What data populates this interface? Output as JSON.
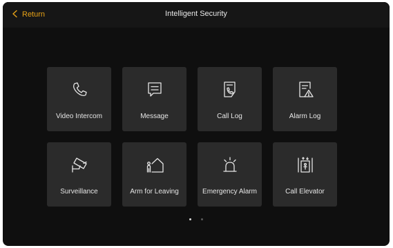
{
  "header": {
    "back_label": "Return",
    "title": "Intelligent Security"
  },
  "tiles": [
    {
      "label": "Video Intercom",
      "icon": "phone-icon"
    },
    {
      "label": "Message",
      "icon": "message-icon"
    },
    {
      "label": "Call Log",
      "icon": "call-log-icon"
    },
    {
      "label": "Alarm Log",
      "icon": "alarm-log-icon"
    },
    {
      "label": "Surveillance",
      "icon": "camera-icon"
    },
    {
      "label": "Arm for Leaving",
      "icon": "arm-leaving-icon"
    },
    {
      "label": "Emergency Alarm",
      "icon": "siren-icon"
    },
    {
      "label": "Call Elevator",
      "icon": "elevator-icon"
    }
  ],
  "pagination": {
    "pages": 2,
    "current": 1
  },
  "colors": {
    "accent": "#e8a317",
    "background": "#0f0f0f",
    "tile": "#2b2b2b",
    "text": "#e6e6e6",
    "dot_active": "#d9d9d9",
    "dot_inactive": "#5a5a5a"
  }
}
